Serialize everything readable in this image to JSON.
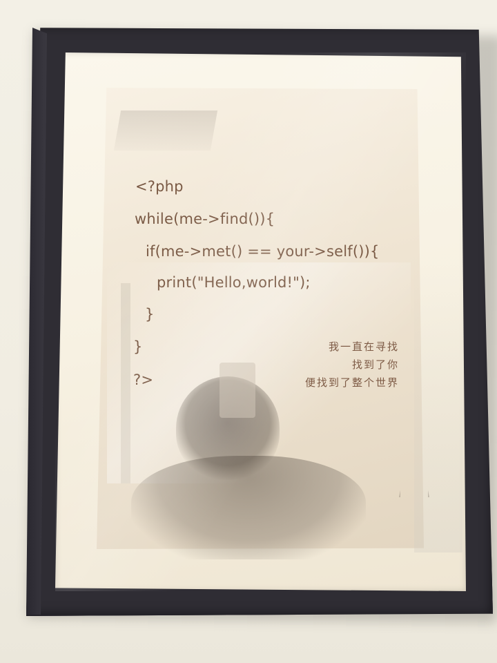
{
  "code_lines": [
    "<?php",
    "while(me->find()){",
    "if(me->met() == your->self()){",
    "print(\"Hello,world!\");",
    "}",
    "}",
    "?>"
  ],
  "chinese_lines": [
    "我一直在寻找",
    "找到了你",
    "便找到了整个世界"
  ]
}
